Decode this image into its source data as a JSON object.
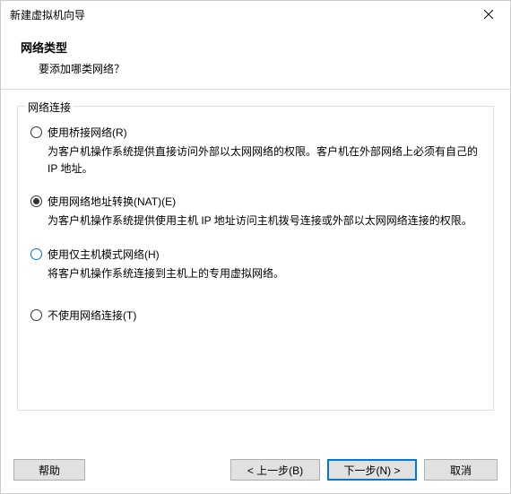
{
  "window": {
    "title": "新建虚拟机向导"
  },
  "header": {
    "title": "网络类型",
    "subtitle": "要添加哪类网络？"
  },
  "group": {
    "label": "网络连接",
    "options": [
      {
        "label": "使用桥接网络(R)",
        "desc": "为客户机操作系统提供直接访问外部以太网网络的权限。客户机在外部网络上必须有自己的 IP 地址。",
        "checked": false,
        "blue": false
      },
      {
        "label": "使用网络地址转换(NAT)(E)",
        "desc": "为客户机操作系统提供使用主机 IP 地址访问主机拨号连接或外部以太网网络连接的权限。",
        "checked": true,
        "blue": false
      },
      {
        "label": "使用仅主机模式网络(H)",
        "desc": "将客户机操作系统连接到主机上的专用虚拟网络。",
        "checked": false,
        "blue": true
      },
      {
        "label": "不使用网络连接(T)",
        "desc": "",
        "checked": false,
        "blue": false
      }
    ]
  },
  "buttons": {
    "help": "帮助",
    "back": "< 上一步(B)",
    "next": "下一步(N) >",
    "cancel": "取消"
  }
}
